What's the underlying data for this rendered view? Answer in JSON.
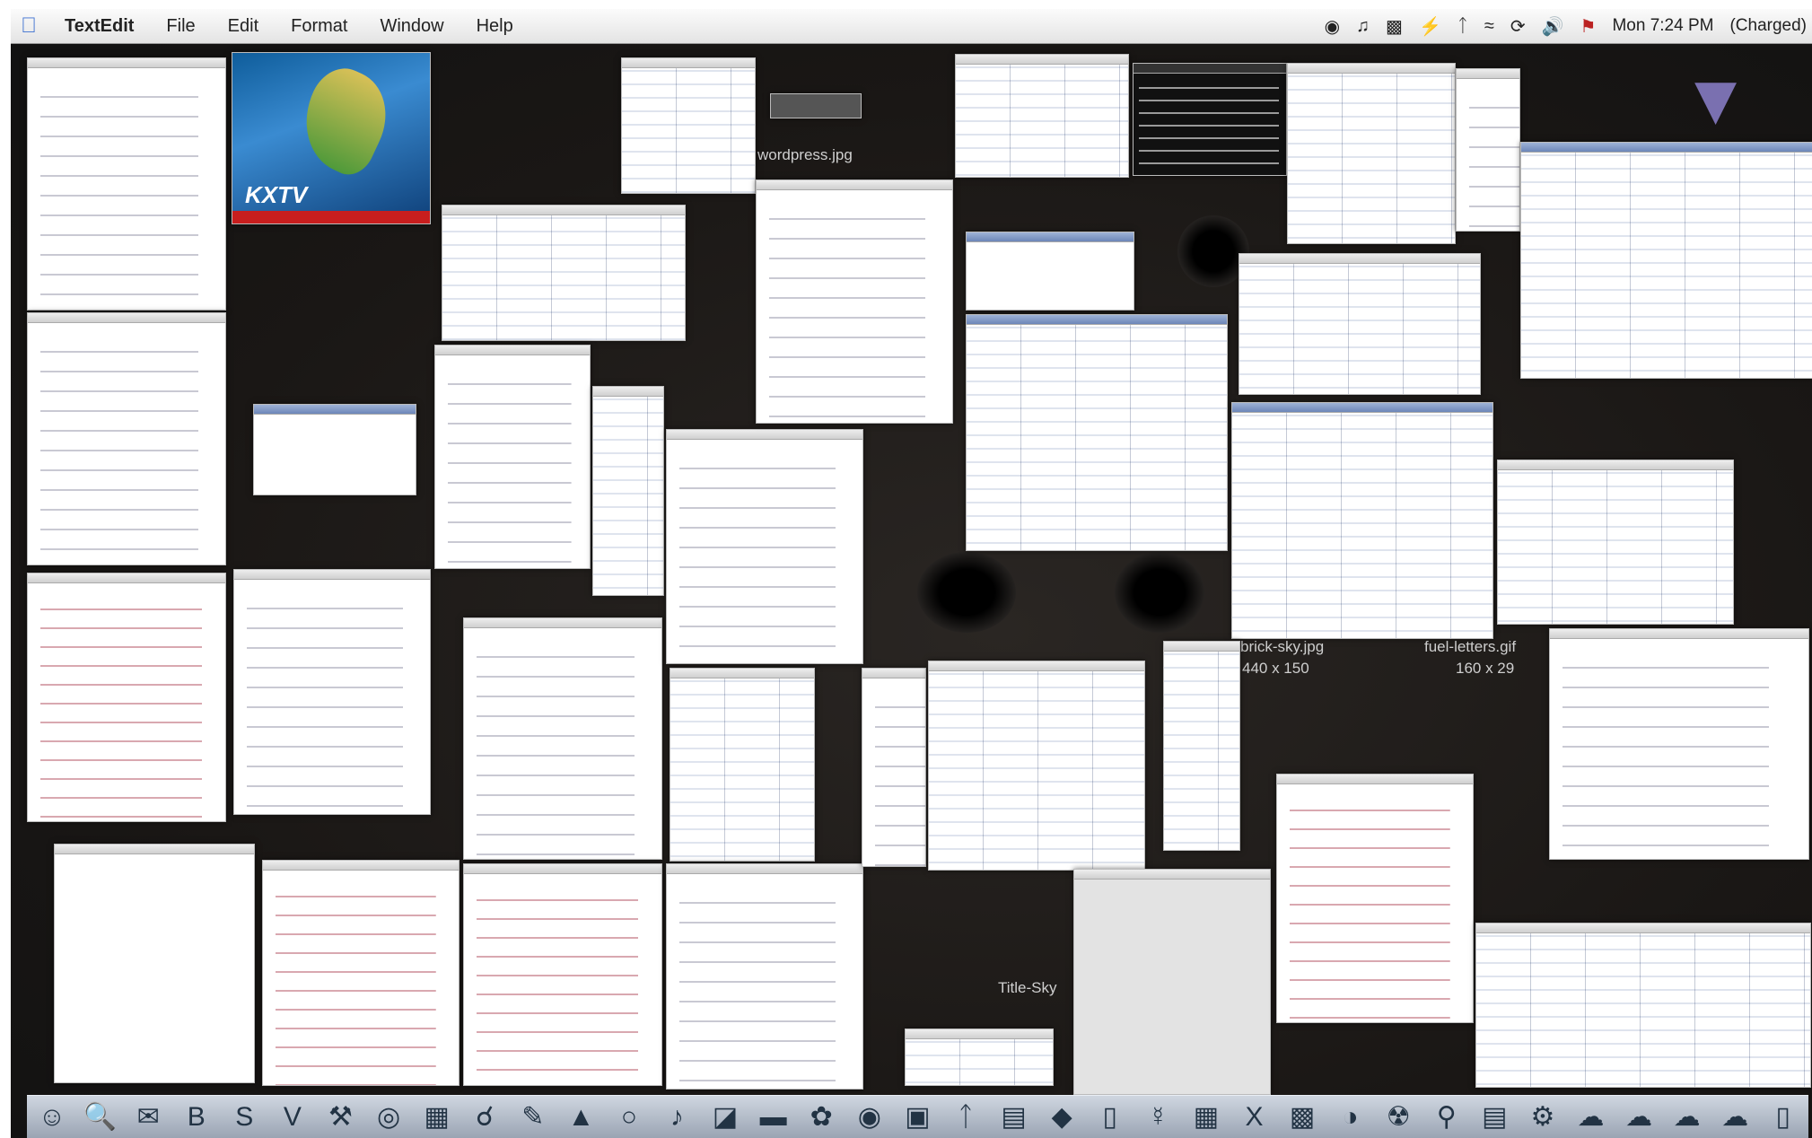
{
  "menubar": {
    "app_name": "TextEdit",
    "menus": [
      "File",
      "Edit",
      "Format",
      "Window",
      "Help"
    ],
    "clock": "Mon 7:24 PM",
    "battery": "(Charged)"
  },
  "desktop": {
    "file_labels": {
      "wordpress": "wordpress.jpg",
      "brick_sky_name": "brick-sky.jpg",
      "brick_sky_size": "440 x 150",
      "fuel_letters_name": "fuel-letters.gif",
      "fuel_letters_size": "160 x 29",
      "tile_label": "Title-Sky"
    }
  },
  "tv_window": {
    "logo": "KXTV"
  },
  "icons": {
    "apple": "apple-icon",
    "status": [
      "sync-icon",
      "music-icon",
      "display-icon",
      "power-icon",
      "bluetooth-icon",
      "wifi-icon",
      "timemachine-icon",
      "volume-icon",
      "flag-icon"
    ],
    "dock": [
      "finder-icon",
      "preview-icon",
      "mail-icon",
      "bbedit-icon",
      "skype-icon",
      "vim-icon",
      "xcode-icon",
      "safari-icon",
      "terminal-icon",
      "network-icon",
      "pencil-icon",
      "adium-icon",
      "globe-icon",
      "itunes-icon",
      "folder-icon",
      "scanner-icon",
      "sunflower-icon",
      "firefox-icon",
      "script-icon",
      "bluetooth-dock-icon",
      "utility-icon",
      "diamond-icon",
      "dictionary-icon",
      "gender-icon",
      "ical-icon",
      "x11-icon",
      "console-icon",
      "disk-icon",
      "nuke-icon",
      "keychain-icon",
      "text-icon",
      "wrench-icon",
      "documents-icon",
      "downloads-icon",
      "network-folder-icon",
      "applications-icon",
      "trash-icon"
    ]
  }
}
